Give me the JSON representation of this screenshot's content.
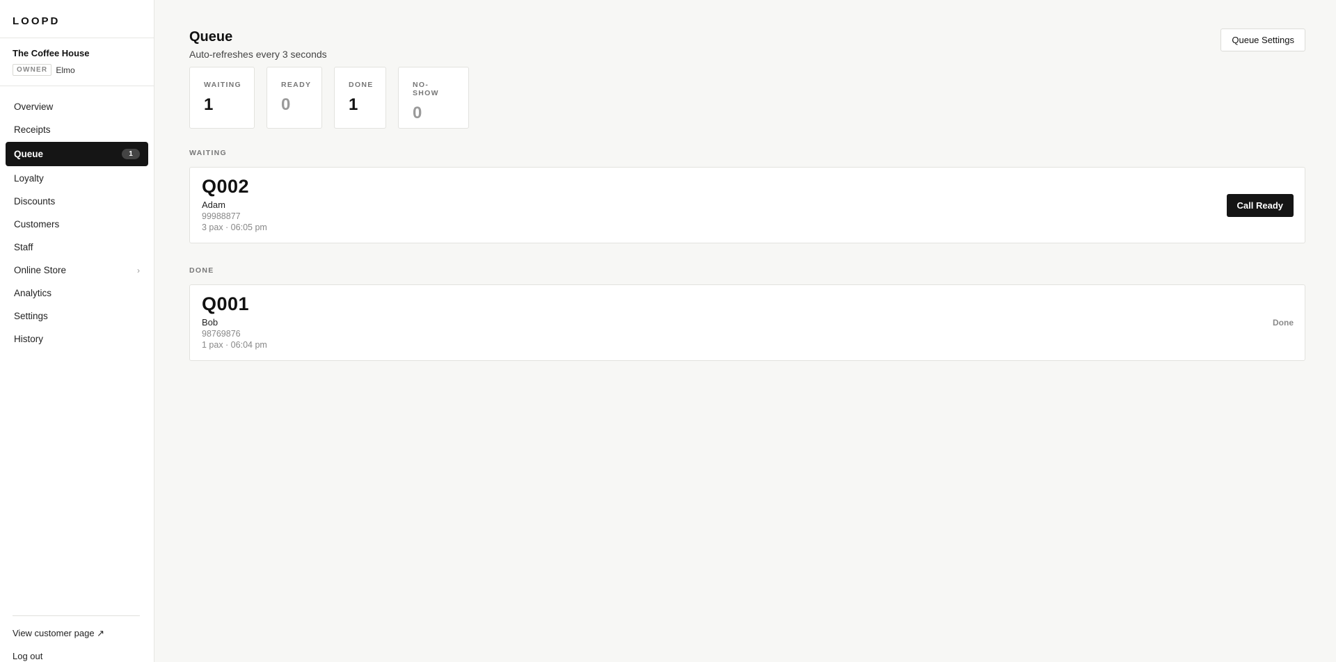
{
  "brand": "LOOPD",
  "org": {
    "name": "The Coffee House",
    "role": "OWNER",
    "user": "Elmo"
  },
  "sidebar": {
    "items": [
      {
        "label": "Overview"
      },
      {
        "label": "Receipts"
      },
      {
        "label": "Queue",
        "badge": "1",
        "active": true
      },
      {
        "label": "Loyalty"
      },
      {
        "label": "Discounts"
      },
      {
        "label": "Customers"
      },
      {
        "label": "Staff"
      },
      {
        "label": "Online Store",
        "chevron": "›"
      },
      {
        "label": "Analytics"
      },
      {
        "label": "Settings"
      },
      {
        "label": "History"
      }
    ],
    "footer": {
      "view_customer": "View customer page ↗",
      "logout": "Log out"
    }
  },
  "header": {
    "title": "Queue",
    "subtitle": "Auto-refreshes every 3 seconds",
    "settings_button": "Queue Settings"
  },
  "stats": [
    {
      "label": "WAITING",
      "value": "1"
    },
    {
      "label": "READY",
      "value": "0"
    },
    {
      "label": "DONE",
      "value": "1"
    },
    {
      "label": "NO-SHOW",
      "value": "0"
    }
  ],
  "sections": {
    "waiting": {
      "label": "WAITING",
      "ticket": {
        "code": "Q002",
        "name": "Adam",
        "phone": "99988877",
        "info": "3 pax · 06:05 pm",
        "action": "Call Ready"
      }
    },
    "done": {
      "label": "DONE",
      "ticket": {
        "code": "Q001",
        "name": "Bob",
        "phone": "98769876",
        "info": "1 pax · 06:04 pm",
        "status": "Done"
      }
    }
  },
  "colors": {
    "accent": "#151515",
    "background": "#f7f7f5",
    "muted": "#9a9a9a"
  }
}
